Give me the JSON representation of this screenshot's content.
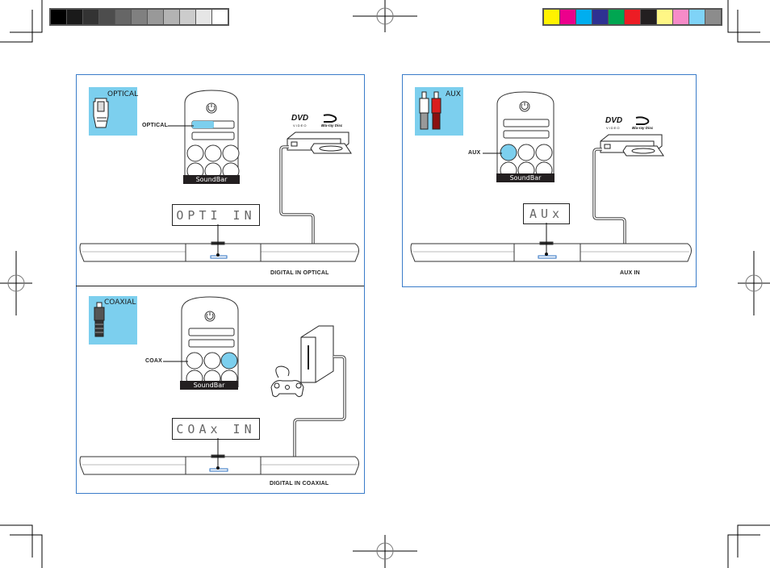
{
  "color_bars": {
    "grayscale": [
      "#000000",
      "#1a1a1a",
      "#333333",
      "#4d4d4d",
      "#666666",
      "#808080",
      "#999999",
      "#b3b3b3",
      "#cccccc",
      "#e6e6e6",
      "#ffffff"
    ],
    "process": [
      "#fff200",
      "#ec008c",
      "#00aeef",
      "#2e3192",
      "#00a651",
      "#ed1c24",
      "#231f20",
      "#fff685",
      "#f68bc8",
      "#7fd3f7",
      "#8c8c8c"
    ]
  },
  "panels": {
    "optical": {
      "connector_label": "OPTICAL",
      "remote_callout": "OPTICAL",
      "remote_brand": "SoundBar",
      "display_text": "OPTI  IN",
      "source_device": "DVD / Blu-ray player",
      "dvd_logo": "DVD",
      "dvd_sub": "VIDEO",
      "bluray_logo": "Blu-ray Disc",
      "caption": "DIGITAL IN OPTICAL"
    },
    "coaxial": {
      "connector_label": "COAXIAL",
      "remote_callout": "COAX",
      "remote_brand": "SoundBar",
      "display_text": "COAx  IN",
      "source_device": "Game console",
      "caption": "DIGITAL IN COAXIAL"
    },
    "aux": {
      "connector_label": "AUX",
      "remote_callout": "AUX",
      "remote_brand": "SoundBar",
      "display_text": "AUx",
      "source_device": "DVD / Blu-ray player",
      "dvd_logo": "DVD",
      "dvd_sub": "VIDEO",
      "bluray_logo": "Blu-ray Disc",
      "caption": "AUX IN"
    }
  },
  "colors": {
    "panel_border": "#3a7cc9",
    "connector_bg": "#7ccfee",
    "highlight": "#7ccfee"
  }
}
